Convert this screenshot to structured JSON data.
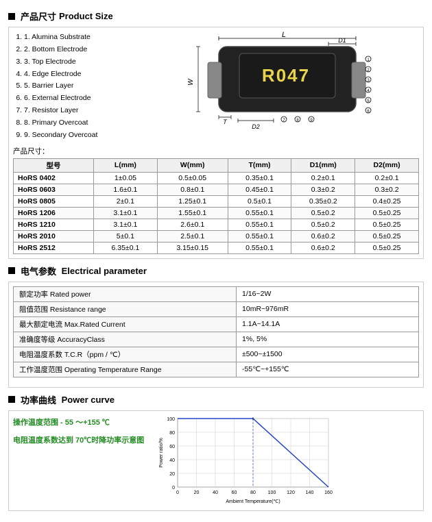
{
  "sections": {
    "product_size": {
      "title_cn": "产品尺寸",
      "title_en": "Product Size",
      "components": [
        "1. Alumina Substrate",
        "2. Bottom Electrode",
        "3. Top Electrode",
        "4. Edge Electrode",
        "5. Barrier Layer",
        "6. External Electrode",
        "7. Resistor Layer",
        "8. Primary Overcoat",
        "9. Secondary Overcoat"
      ],
      "table": {
        "label_cn": "产品尺寸：",
        "headers": [
          "型号",
          "L(mm)",
          "W(mm)",
          "T(mm)",
          "D1(mm)",
          "D2(mm)"
        ],
        "rows": [
          [
            "HoRS 0402",
            "1±0.05",
            "0.5±0.05",
            "0.35±0.1",
            "0.2±0.1",
            "0.2±0.1"
          ],
          [
            "HoRS 0603",
            "1.6±0.1",
            "0.8±0.1",
            "0.45±0.1",
            "0.3±0.2",
            "0.3±0.2"
          ],
          [
            "HoRS 0805",
            "2±0.1",
            "1.25±0.1",
            "0.5±0.1",
            "0.35±0.2",
            "0.4±0.25"
          ],
          [
            "HoRS 1206",
            "3.1±0.1",
            "1.55±0.1",
            "0.55±0.1",
            "0.5±0.2",
            "0.5±0.25"
          ],
          [
            "HoRS 1210",
            "3.1±0.1",
            "2.6±0.1",
            "0.55±0.1",
            "0.5±0.2",
            "0.5±0.25"
          ],
          [
            "HoRS 2010",
            "5±0.1",
            "2.5±0.1",
            "0.55±0.1",
            "0.6±0.2",
            "0.5±0.25"
          ],
          [
            "HoRS 2512",
            "6.35±0.1",
            "3.15±0.15",
            "0.55±0.1",
            "0.6±0.2",
            "0.5±0.25"
          ]
        ]
      }
    },
    "electrical": {
      "title_cn": "电气参数",
      "title_en": "Electrical parameter",
      "params": [
        {
          "label": "额定功率 Rated power",
          "value": "1/16~2W"
        },
        {
          "label": "阻值范围 Resistance range",
          "value": "10mR~976mR"
        },
        {
          "label": "最大额定电流 Max.Rated Current",
          "value": "1.1A~14.1A"
        },
        {
          "label": "准确度等级 AccuracyClass",
          "value": "1%, 5%"
        },
        {
          "label": "电阻温度系数 T.C.R（ppm / ℃）",
          "value": "±500~±1500"
        },
        {
          "label": "工作温度范围 Operating Temperature Range",
          "value": "-55℃~+155℃"
        }
      ]
    },
    "power_curve": {
      "title_cn": "功率曲线",
      "title_en": "Power curve",
      "op_range_label": "操作温度范围 - 55 ～+155 ℃",
      "temp_note_label": "电阻温度系数达到 70℃时降功率示意图",
      "chart": {
        "y_label": "Power ratio/%",
        "x_label": "Ambient Temperature(℃)",
        "y_ticks": [
          0,
          20,
          40,
          60,
          80,
          100
        ],
        "x_ticks": [
          0,
          20,
          40,
          60,
          80,
          100,
          120,
          140,
          160
        ],
        "line_points": [
          [
            0,
            100
          ],
          [
            70,
            100
          ],
          [
            155,
            0
          ]
        ]
      }
    }
  }
}
